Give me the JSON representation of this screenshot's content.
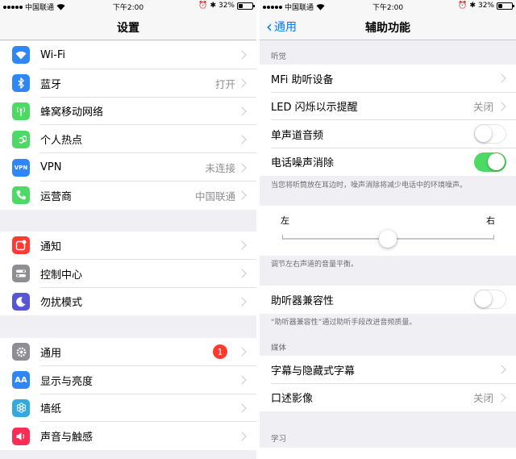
{
  "status_left": {
    "carrier": "中国联通",
    "time": "下午2:00",
    "battery": "32%",
    "battery_level": 0.32
  },
  "status_right": {
    "carrier": "中国联通",
    "time": "下午2:00",
    "battery": "32%",
    "battery_level": 0.32
  },
  "settings": {
    "title": "设置",
    "groups": [
      [
        {
          "label": "Wi-Fi",
          "value": "",
          "icon": "wifi-icon",
          "color": "#2f86f6"
        },
        {
          "label": "蓝牙",
          "value": "打开",
          "icon": "bluetooth-icon",
          "color": "#2f86f6"
        },
        {
          "label": "蜂窝移动网络",
          "value": "",
          "icon": "cellular-icon",
          "color": "#4cd964"
        },
        {
          "label": "个人热点",
          "value": "",
          "icon": "hotspot-icon",
          "color": "#4cd964"
        },
        {
          "label": "VPN",
          "value": "未连接",
          "icon": "vpn-icon",
          "color": "#2f86f6",
          "icon_text": "VPN"
        },
        {
          "label": "运营商",
          "value": "中国联通",
          "icon": "phone-icon",
          "color": "#4cd964"
        }
      ],
      [
        {
          "label": "通知",
          "value": "",
          "icon": "notifications-icon",
          "color": "#ff3b30"
        },
        {
          "label": "控制中心",
          "value": "",
          "icon": "control-center-icon",
          "color": "#8e8e93"
        },
        {
          "label": "勿扰模式",
          "value": "",
          "icon": "moon-icon",
          "color": "#5856d6"
        }
      ],
      [
        {
          "label": "通用",
          "value": "",
          "icon": "gear-icon",
          "color": "#8e8e93",
          "badge": "1"
        },
        {
          "label": "显示与亮度",
          "value": "",
          "icon": "display-icon",
          "color": "#2f86f6",
          "icon_text": "AA"
        },
        {
          "label": "墙纸",
          "value": "",
          "icon": "wallpaper-icon",
          "color": "#34aadc"
        },
        {
          "label": "声音与触感",
          "value": "",
          "icon": "sound-icon",
          "color": "#ff2d55"
        }
      ]
    ]
  },
  "accessibility": {
    "back_label": "通用",
    "title": "辅助功能",
    "section_hearing": "听觉",
    "hearing_rows": [
      {
        "label": "MFi 助听设备",
        "value": "",
        "type": "chevron"
      },
      {
        "label": "LED 闪烁以示提醒",
        "value": "关闭",
        "type": "chevron"
      },
      {
        "label": "单声道音频",
        "value": "",
        "type": "toggle",
        "on": false
      },
      {
        "label": "电话噪声消除",
        "value": "",
        "type": "toggle",
        "on": true
      }
    ],
    "noise_footnote": "当您将听筒放在耳边时，噪声消除将减少电话中的环境噪声。",
    "balance_left": "左",
    "balance_right": "右",
    "balance_value": 0.5,
    "balance_footnote": "调节左右声道的音量平衡。",
    "hac_label": "助听器兼容性",
    "hac_on": false,
    "hac_footnote": "“助听器兼容性”通过助听手段改进音频质量。",
    "section_media": "媒体",
    "media_rows": [
      {
        "label": "字幕与隐藏式字幕",
        "value": ""
      },
      {
        "label": "口述影像",
        "value": "关闭"
      }
    ],
    "section_learning": "学习"
  }
}
